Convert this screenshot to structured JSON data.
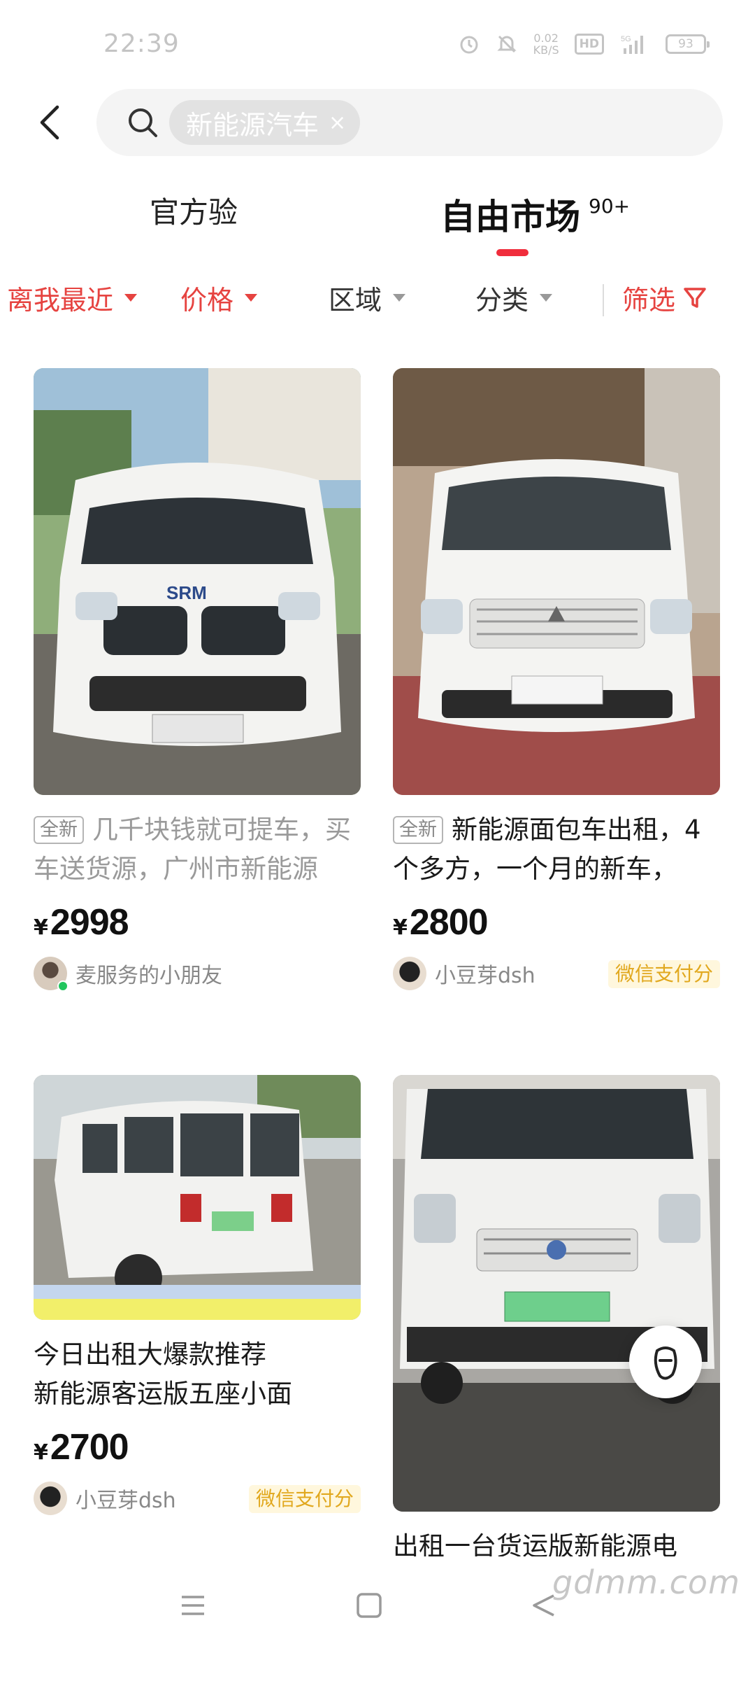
{
  "status_bar": {
    "time": "22:39",
    "net_speed_value": "0.02",
    "net_speed_unit": "KB/S",
    "hd_label": "HD",
    "signal_label": "5G",
    "battery": "93"
  },
  "search": {
    "keyword": "新能源汽车",
    "clear_symbol": "×"
  },
  "tabs": {
    "official": "官方验",
    "market": "自由市场",
    "market_count": "90+"
  },
  "filters": {
    "nearest": "离我最近",
    "price": "价格",
    "region": "区域",
    "category": "分类",
    "screen": "筛选"
  },
  "listings": [
    {
      "tag": "全新",
      "title": "几千块钱就可提车，买车送货源，广州市新能源",
      "price_symbol": "¥",
      "price": "2998",
      "seller": "麦服务的小朋友",
      "badge": ""
    },
    {
      "tag": "全新",
      "title": "新能源面包车出租，4个多方，一个月的新车，",
      "price_symbol": "¥",
      "price": "2800",
      "seller": "小豆芽dsh",
      "badge": "微信支付分"
    },
    {
      "tag": "",
      "title": "今日出租大爆款推荐\n新能源客运版五座小面",
      "price_symbol": "¥",
      "price": "2700",
      "seller": "小豆芽dsh",
      "badge": "微信支付分"
    },
    {
      "tag": "",
      "title": "出租一台货运版新能源电车，",
      "price_symbol": "",
      "price": "",
      "seller": "",
      "badge": ""
    }
  ],
  "watermark": "gdmm.com",
  "colors": {
    "accent_red": "#e64340",
    "tab_indicator": "#f02d3c",
    "wechat_badge_text": "#e1a81e",
    "wechat_badge_bg": "#fff7dd"
  },
  "icons": [
    "back-icon",
    "search-icon",
    "filter-funnel-icon",
    "footprint-icon",
    "menu-icon",
    "home-square-icon",
    "back-triangle-icon"
  ]
}
